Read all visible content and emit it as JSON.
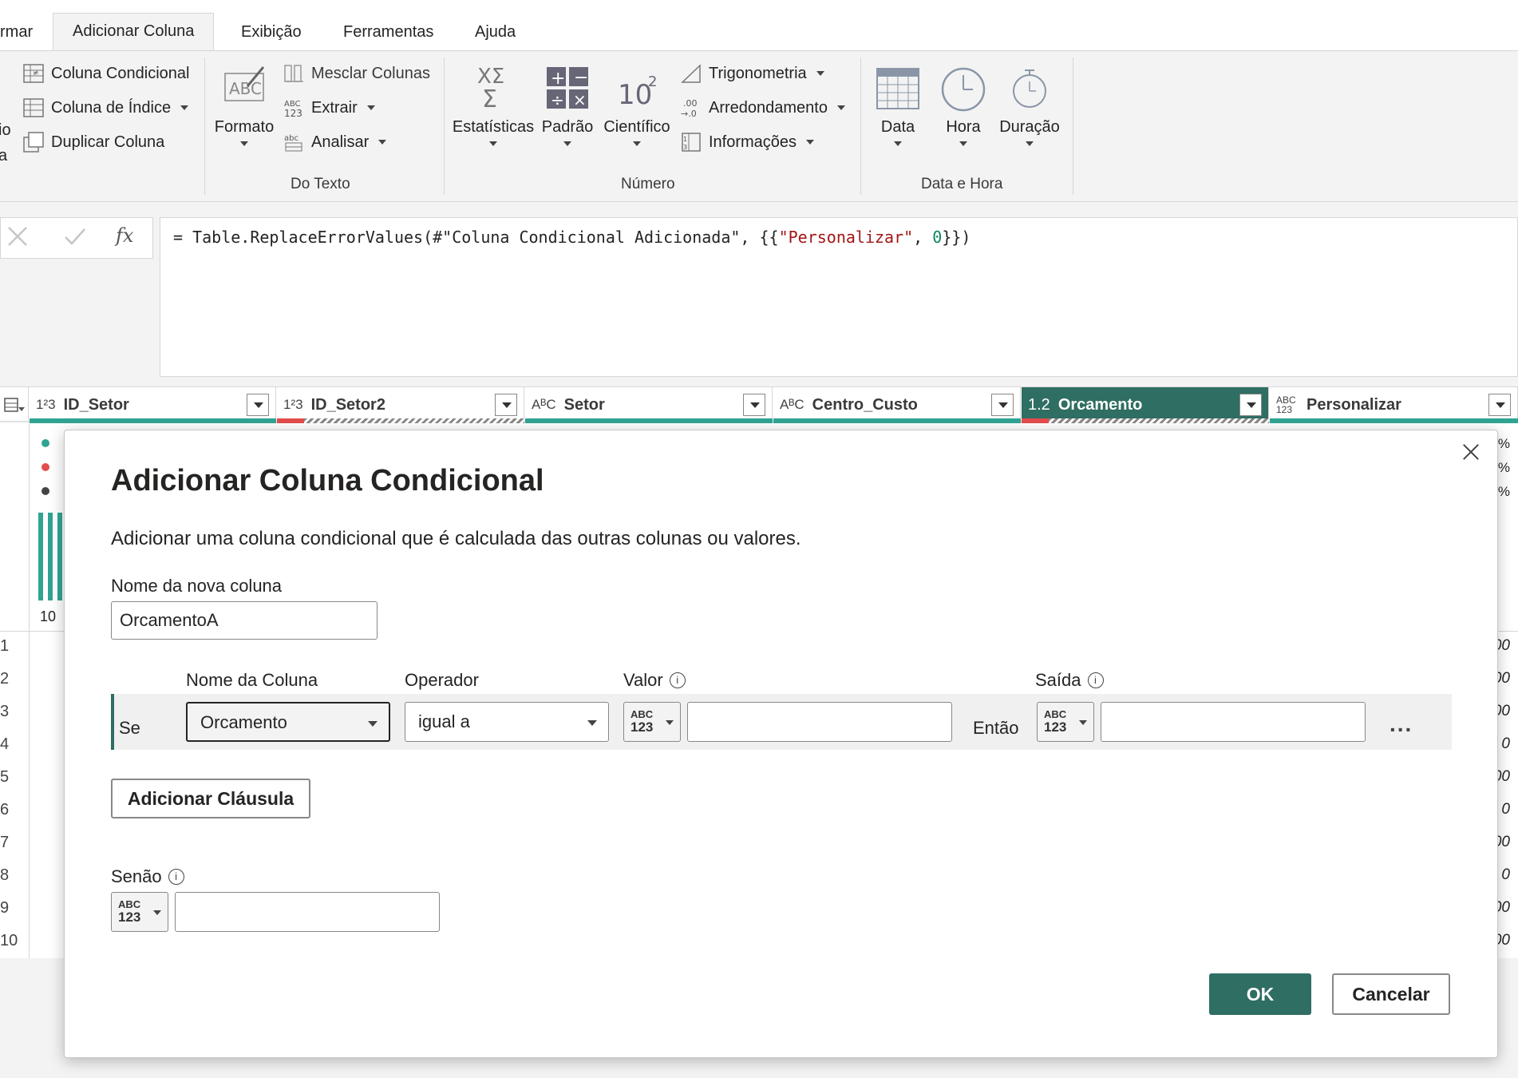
{
  "tabs": [
    {
      "label": "rmar"
    },
    {
      "label": "Adicionar Coluna"
    },
    {
      "label": "Exibição"
    },
    {
      "label": "Ferramentas"
    },
    {
      "label": "Ajuda"
    }
  ],
  "ribbon": {
    "left_cut": {
      "line1": "io",
      "line2": "a"
    },
    "general": {
      "coluna_condicional": "Coluna Condicional",
      "coluna_indice": "Coluna de Índice",
      "duplicar_coluna": "Duplicar Coluna"
    },
    "texto": {
      "formato": "Formato",
      "mesclar": "Mesclar Colunas",
      "extrair": "Extrair",
      "analisar": "Analisar",
      "group_label": "Do Texto"
    },
    "numero": {
      "estatisticas": "Estatísticas",
      "padrao": "Padrão",
      "cientifico": "Científico",
      "trigonometria": "Trigonometria",
      "arredondamento": "Arredondamento",
      "informacoes": "Informações",
      "group_label": "Número"
    },
    "data_hora": {
      "data": "Data",
      "hora": "Hora",
      "duracao": "Duração",
      "group_label": "Data e Hora"
    }
  },
  "formula": {
    "p1": "= Table.ReplaceErrorValues(#\"Coluna Condicional Adicionada\", {{",
    "p2": "\"Personalizar\"",
    "p3": ", ",
    "p4": "0",
    "p5": "}})"
  },
  "grid": {
    "columns": [
      {
        "type": "1²3",
        "name": "ID_Setor"
      },
      {
        "type": "1²3",
        "name": "ID_Setor2"
      },
      {
        "type": "AᴮC",
        "name": "Setor"
      },
      {
        "type": "AᴮC",
        "name": "Centro_Custo"
      },
      {
        "type": "1.2",
        "name": "Orcamento"
      },
      {
        "type": "ABC 123",
        "name": "Personalizar"
      }
    ],
    "row_numbers": [
      "1",
      "2",
      "3",
      "4",
      "5",
      "6",
      "7",
      "8",
      "9",
      "10"
    ],
    "right_values": [
      "00",
      "00",
      "00",
      "0",
      "00",
      "0",
      "00",
      "0",
      "00",
      "00"
    ],
    "right_pct": [
      "%",
      "%",
      "%"
    ],
    "profile_count": "10"
  },
  "dialog": {
    "title": "Adicionar Coluna Condicional",
    "description": "Adicionar uma coluna condicional que é calculada das outras colunas ou valores.",
    "new_col_label": "Nome da nova coluna",
    "new_col_value": "OrcamentoA",
    "headers": {
      "column": "Nome da Coluna",
      "operator": "Operador",
      "value": "Valor",
      "output": "Saída"
    },
    "clause": {
      "se": "Se",
      "column": "Orcamento",
      "operator": "igual a",
      "type_top": "ABC",
      "type_bottom": "123",
      "value": "",
      "entao": "Então",
      "output": ""
    },
    "add_clause": "Adicionar Cláusula",
    "else_label": "Senão",
    "else_value": "",
    "ok": "OK",
    "cancel": "Cancelar",
    "ellipsis": "..."
  }
}
